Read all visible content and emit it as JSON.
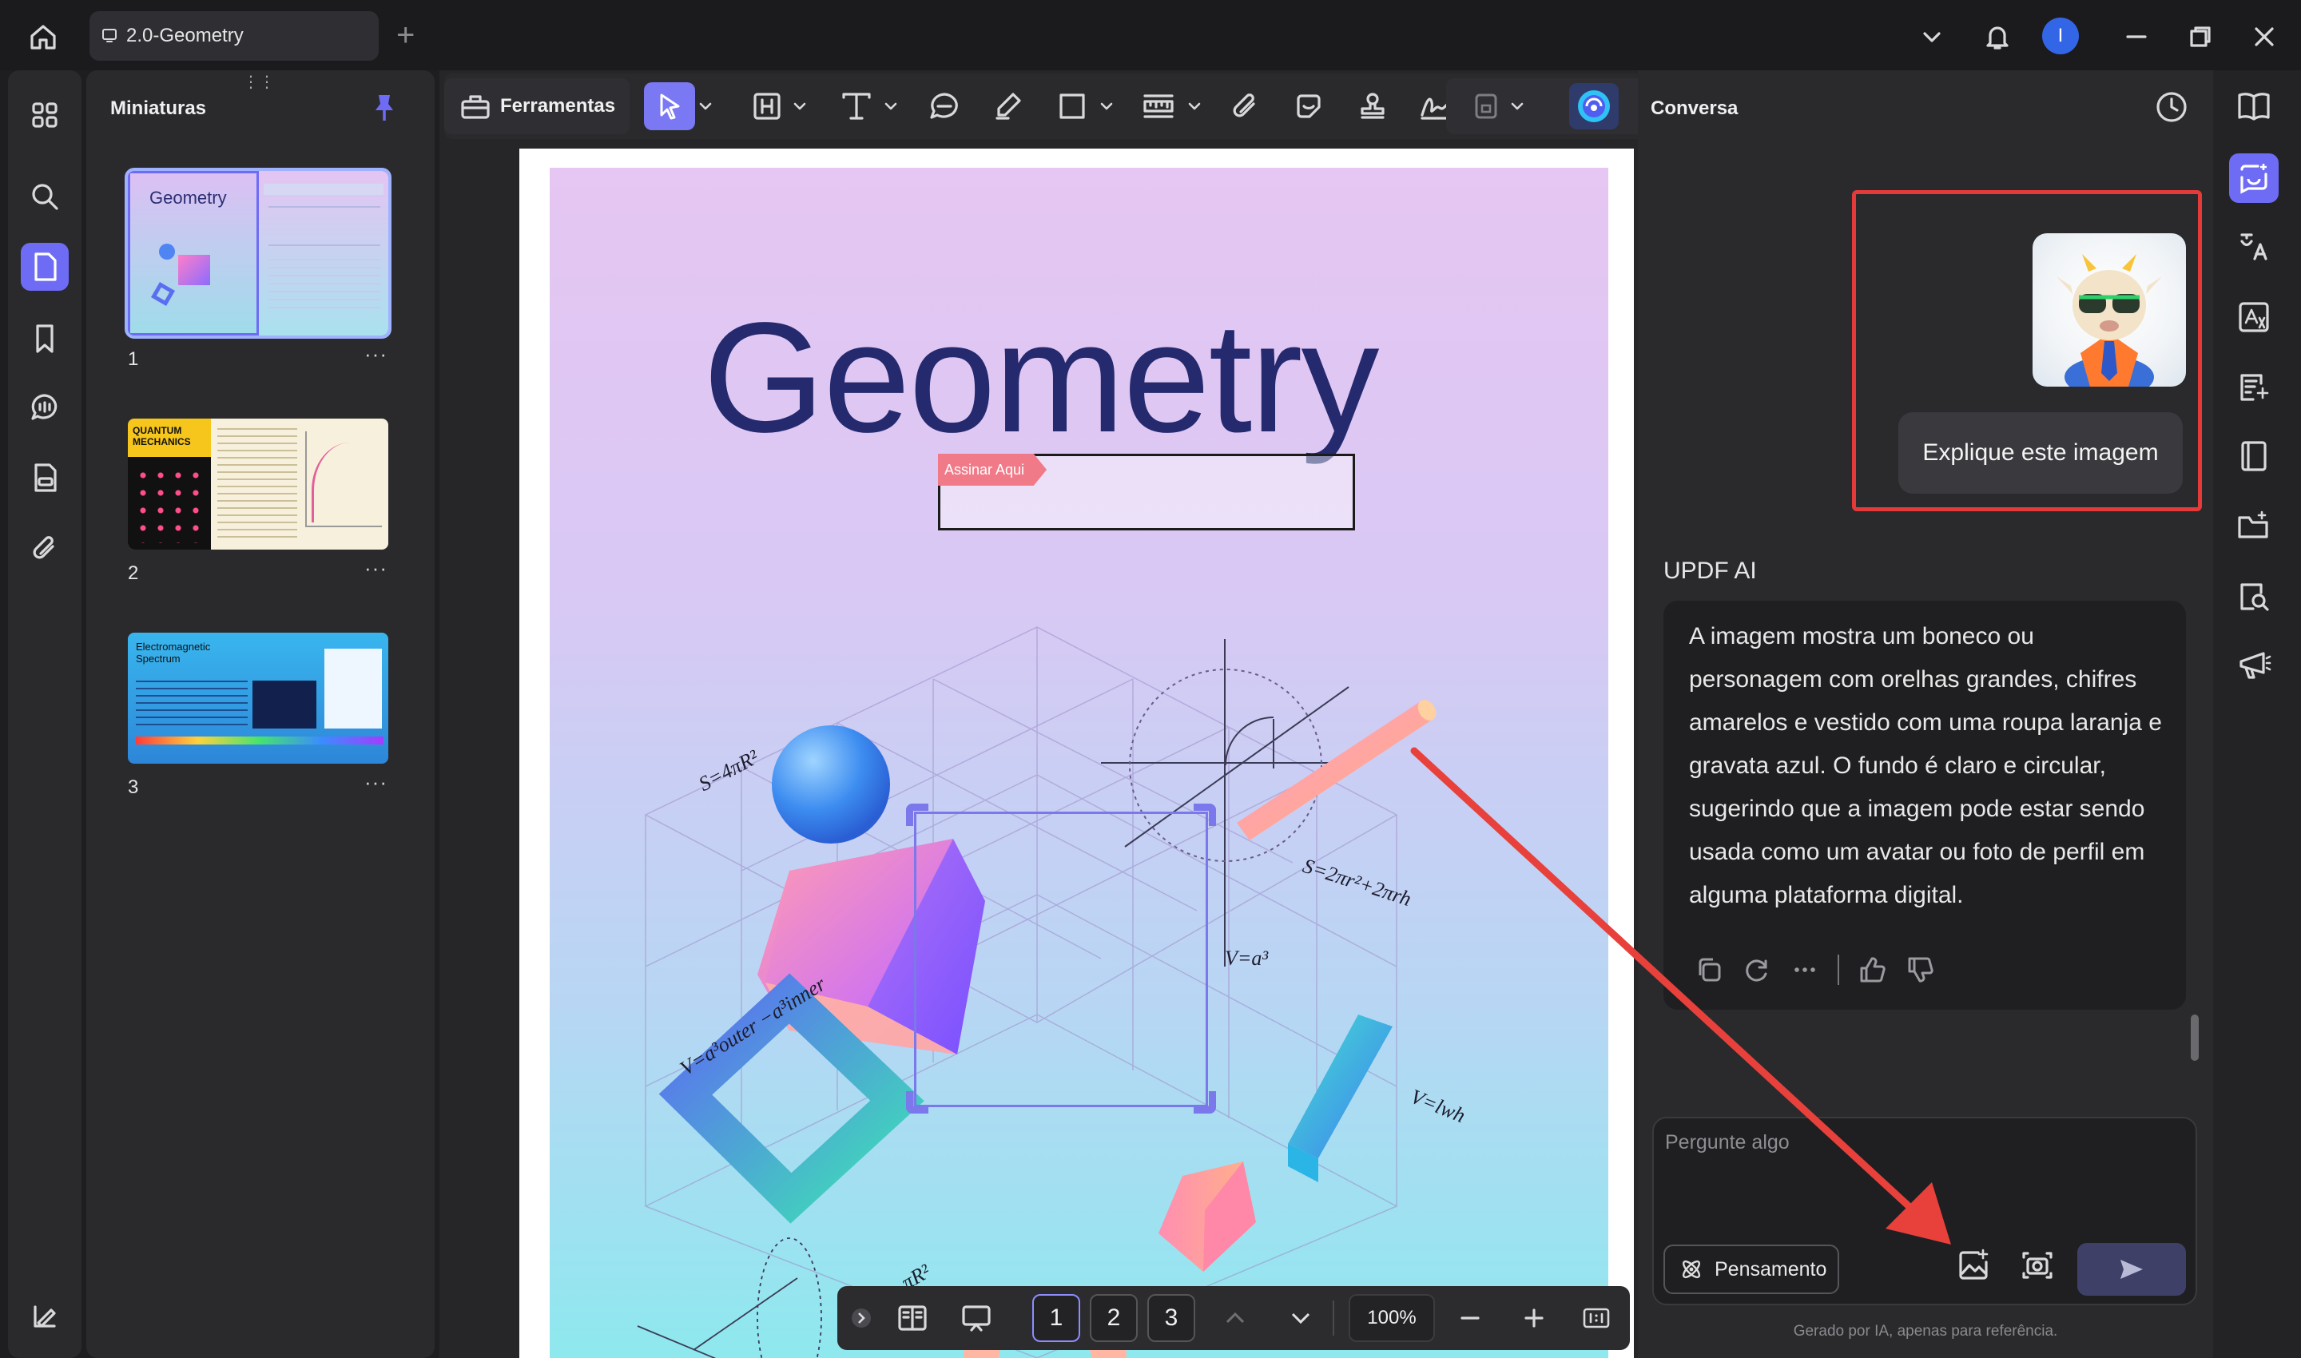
{
  "titlebar": {
    "tab_title": "2.0-Geometry",
    "new_tab": "+",
    "avatar_initial": "I"
  },
  "thumbnails": {
    "title": "Miniaturas",
    "pages": [
      {
        "label": "1",
        "more": "···",
        "caption": "Geometry"
      },
      {
        "label": "2",
        "more": "···",
        "caption": "QUANTUM MECHANICS"
      },
      {
        "label": "3",
        "more": "···",
        "caption": "Electromagnetic Spectrum"
      }
    ],
    "drag_handle": "⋮⋮"
  },
  "toolbar": {
    "tools_label": "Ferramentas"
  },
  "document": {
    "title": "Geometry",
    "sign_tag": "Assinar Aqui",
    "formulas": {
      "sphere": "S=4πR²",
      "cylinder": "S=2πr²+2πrh",
      "cube": "V=a³",
      "frame": "V=a³outer −a³inner",
      "prism": "V=lwh",
      "cone": "πR²"
    }
  },
  "pagenav": {
    "pages": [
      "1",
      "2",
      "3"
    ],
    "current": "1",
    "zoom": "100%"
  },
  "chat": {
    "title": "Conversa",
    "user_message": "Explique este imagem",
    "ai_name": "UPDF AI",
    "ai_response": "A imagem mostra um boneco ou personagem com orelhas grandes, chifres amarelos e vestido com uma roupa laranja e gravata azul. O fundo é claro e circular, sugerindo que a imagem pode estar sendo usada como um avatar ou foto de perfil em alguma plataforma digital.",
    "input_placeholder": "Pergunte algo",
    "thinking_label": "Pensamento",
    "footnote": "Gerado por IA, apenas para referência."
  },
  "colors": {
    "accent": "#6e6cf5",
    "highlight_box": "#e43a3a",
    "arrow": "#e8413c"
  }
}
